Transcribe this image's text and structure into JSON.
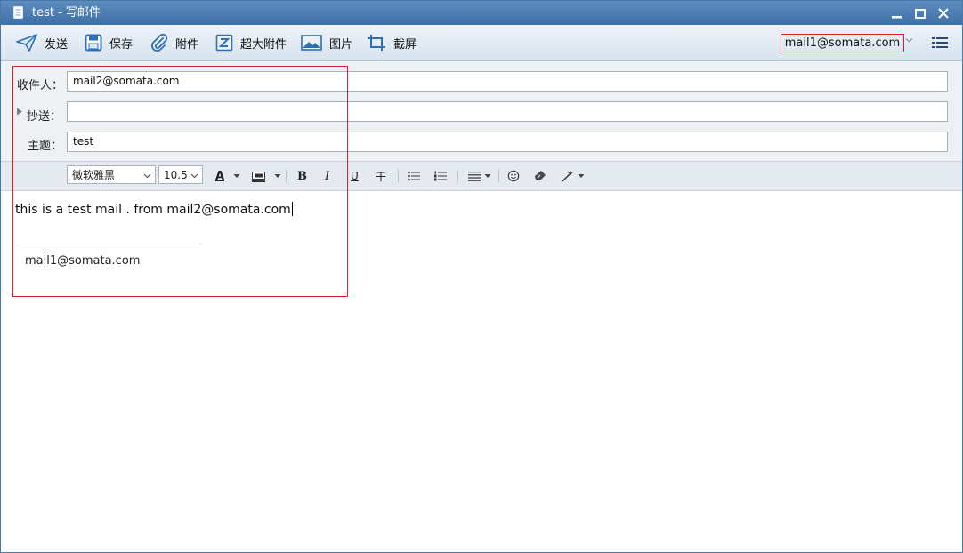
{
  "window": {
    "title": "test - 写邮件"
  },
  "toolbar": {
    "send_label": "发送",
    "save_label": "保存",
    "attach_label": "附件",
    "big_attach_label": "超大附件",
    "image_label": "图片",
    "screenshot_label": "截屏",
    "account": "mail1@somata.com"
  },
  "fields": {
    "to_label": "收件人：",
    "to_value": "mail2@somata.com",
    "cc_label": "抄送：",
    "cc_value": "",
    "subject_label": "主题：",
    "subject_value": "test"
  },
  "format": {
    "font_family": "微软雅黑",
    "font_size": "10.5",
    "font_color_glyph": "A",
    "bold_glyph": "B",
    "italic_glyph": "I",
    "underline_glyph": "U",
    "strike_glyph": "干"
  },
  "body": {
    "text": "this is a test mail . from mail2@somata.com",
    "signature": "mail1@somata.com"
  },
  "colors": {
    "titlebar": "#4a7bb0",
    "highlight_box": "#e02020",
    "accent": "#2f6fb5"
  }
}
